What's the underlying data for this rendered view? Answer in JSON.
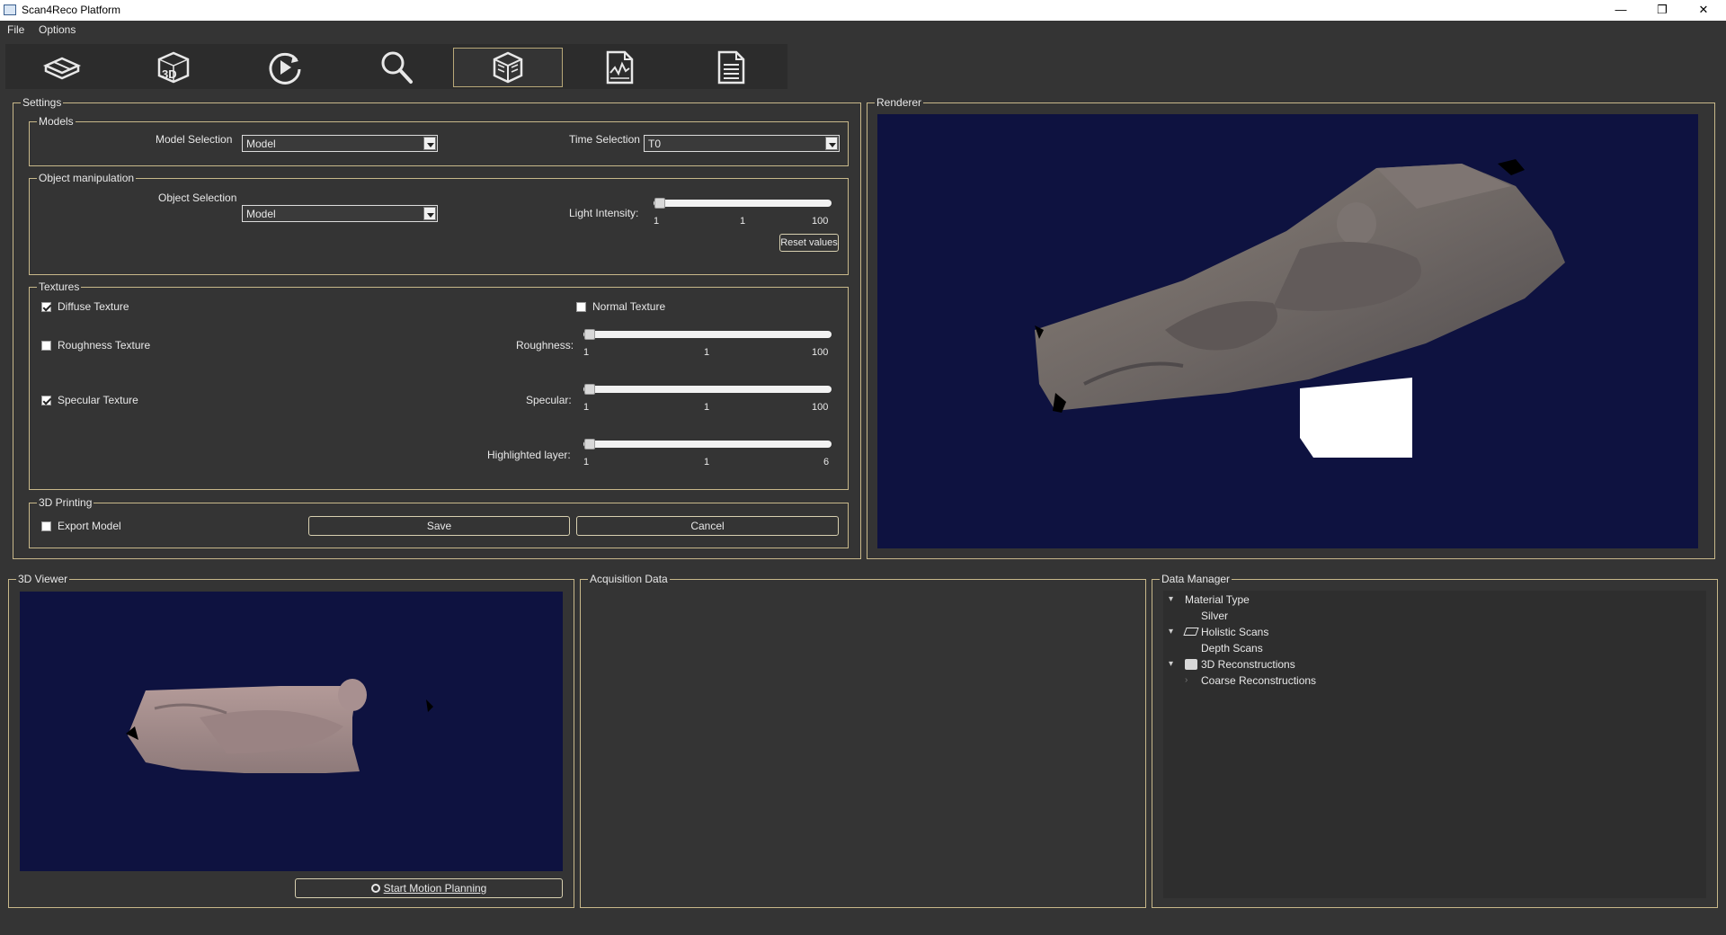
{
  "window": {
    "title": "Scan4Reco Platform",
    "minimize_glyph": "—",
    "restore_glyph": "❐",
    "close_glyph": "✕"
  },
  "menu": {
    "file": "File",
    "options": "Options"
  },
  "toolbar": {
    "tools": [
      {
        "icon": "holistic-scan-icon"
      },
      {
        "icon": "3d-reconstruction-icon"
      },
      {
        "icon": "playback-icon"
      },
      {
        "icon": "search-icon"
      },
      {
        "icon": "rendering-cube-icon",
        "active": true
      },
      {
        "icon": "chart-document-icon"
      },
      {
        "icon": "report-document-icon"
      }
    ]
  },
  "settings": {
    "title": "Settings",
    "models": {
      "title": "Models",
      "model_selection_label": "Model Selection",
      "model_selection_value": "Model",
      "time_selection_label": "Time Selection",
      "time_selection_value": "T0"
    },
    "object_manipulation": {
      "title": "Object manipulation",
      "object_selection_label": "Object Selection",
      "object_selection_value": "Model",
      "light_intensity_label": "Light Intensity:",
      "light_min": "1",
      "light_value": "1",
      "light_max": "100",
      "reset_label": "Reset values"
    },
    "textures": {
      "title": "Textures",
      "diffuse_label": "Diffuse Texture",
      "diffuse_checked": true,
      "normal_label": "Normal Texture",
      "normal_checked": false,
      "roughness_tex_label": "Roughness Texture",
      "roughness_tex_checked": false,
      "specular_tex_label": "Specular Texture",
      "specular_tex_checked": true,
      "roughness_label": "Roughness:",
      "roughness_min": "1",
      "roughness_value": "1",
      "roughness_max": "100",
      "specular_label": "Specular:",
      "specular_min": "1",
      "specular_value": "1",
      "specular_max": "100",
      "highlighted_label": "Highlighted layer:",
      "highlighted_min": "1",
      "highlighted_value": "1",
      "highlighted_max": "6"
    },
    "printing": {
      "title": "3D Printing",
      "export_label": "Export Model",
      "export_checked": false,
      "save_label": "Save",
      "cancel_label": "Cancel"
    }
  },
  "renderer": {
    "title": "Renderer"
  },
  "viewer": {
    "title": "3D Viewer",
    "motion_label": "Start Motion Planning"
  },
  "acquisition": {
    "title": "Acquisition Data"
  },
  "data_manager": {
    "title": "Data Manager",
    "items": [
      {
        "label": "Material Type"
      },
      {
        "label": "Silver"
      },
      {
        "label": "Holistic Scans"
      },
      {
        "label": "Depth Scans"
      },
      {
        "label": "3D Reconstructions"
      },
      {
        "label": "Coarse Reconstructions"
      }
    ]
  },
  "colors": {
    "background": "#343434",
    "frame": "#c8b88a",
    "viewport": "#0e1240"
  }
}
